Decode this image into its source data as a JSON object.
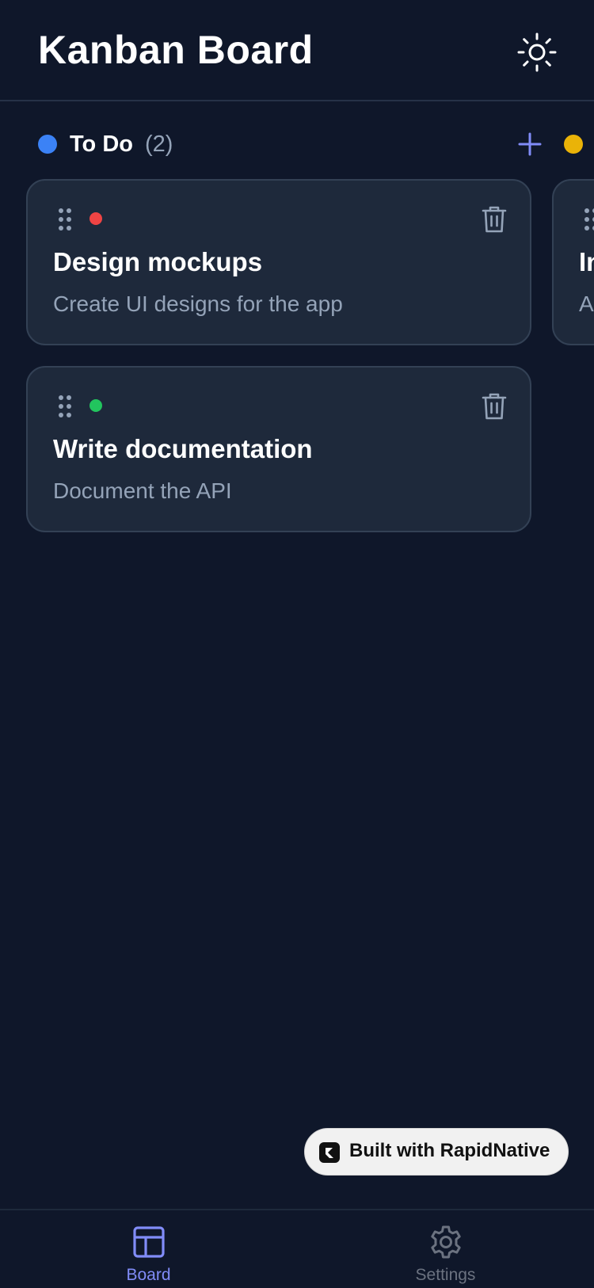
{
  "header": {
    "title": "Kanban Board",
    "theme_toggle_icon": "sun-icon"
  },
  "columns": [
    {
      "title": "To Do",
      "count": "(2)",
      "color": "#3b82f6",
      "add_icon": "plus-icon",
      "cards": [
        {
          "title": "Design mockups",
          "description": "Create UI designs for the app",
          "priority_color": "#ef4444"
        },
        {
          "title": "Write documentation",
          "description": "Document the API",
          "priority_color": "#22c55e"
        }
      ]
    },
    {
      "color": "#eab308",
      "cards": [
        {
          "title": "In",
          "description": "A"
        }
      ]
    }
  ],
  "badge": {
    "label": "Built with RapidNative"
  },
  "tabs": [
    {
      "label": "Board",
      "icon": "board-icon",
      "active": true,
      "color": "#818cf8"
    },
    {
      "label": "Settings",
      "icon": "gear-icon",
      "active": false,
      "color": "#6b7280"
    }
  ],
  "colors": {
    "background": "#0f172a",
    "card": "#1e293b",
    "accent": "#818cf8",
    "muted_text": "#94a3b8"
  }
}
